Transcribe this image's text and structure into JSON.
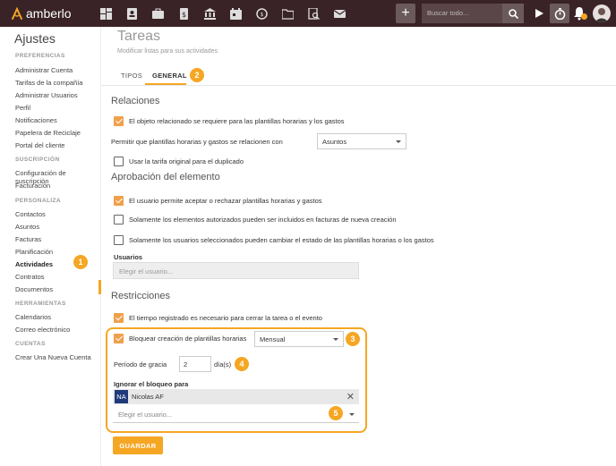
{
  "app": {
    "name": "amberlo"
  },
  "topbar": {
    "nav_icons": [
      "dashboard-icon",
      "contacts-icon",
      "briefcase-icon",
      "invoice-icon",
      "bank-icon",
      "calendar-icon",
      "time-history-icon",
      "folder-icon",
      "document-search-icon",
      "mail-icon"
    ],
    "plus_label": "+",
    "search_placeholder": "Buscar todo..."
  },
  "sidebar": {
    "title": "Ajustes",
    "sections": [
      {
        "label": "PREFERENCIAS",
        "items": [
          "Administrar Cuenta",
          "Tarifas de la compañía",
          "Administrar Usuarios",
          "Perfil",
          "Notificaciones",
          "Papelera de Reciclaje",
          "Portal del cliente"
        ]
      },
      {
        "label": "SUSCRIPCIÓN",
        "items": [
          "Configuración de suscripción",
          "Facturación"
        ]
      },
      {
        "label": "PERSONALIZA",
        "items": [
          "Contactos",
          "Asuntos",
          "Facturas",
          "Planificación",
          "Actividades",
          "Contratos",
          "Documentos"
        ]
      },
      {
        "label": "HERRAMIENTAS",
        "items": [
          "Calendarios",
          "Correo electrónico"
        ]
      },
      {
        "label": "CUENTAS",
        "items": [
          "Crear Una Nueva Cuenta"
        ]
      }
    ],
    "active_item": "Actividades"
  },
  "page": {
    "title": "Tareas",
    "subtitle": "Modificar listas para sus actividades",
    "tabs": [
      "TIPOS",
      "GENERAL"
    ]
  },
  "relaciones": {
    "heading": "Relaciones",
    "cb1_label": "El objeto relacionado se requiere para las plantillas horarias y los gastos",
    "cb1_checked": true,
    "relate_label": "Permitir que plantillas horarias y gastos se relacionen con",
    "relate_value": "Asuntos",
    "cb2_label": "Usar la tarifa original para el duplicado",
    "cb2_checked": false
  },
  "aprobacion": {
    "heading": "Aprobación del elemento",
    "cb1_label": "El usuario permite aceptar o rechazar plantillas horarias y gastos",
    "cb2_label": "Solamente los elementos autorizados pueden ser incluidos en facturas de nueva creación",
    "cb3_label": "Solamente los usuarios seleccionados pueden cambiar el estado de las plantillas horarias o los gastos",
    "users_label": "Usuarios",
    "users_placeholder": "Elegir el usuario..."
  },
  "restricciones": {
    "heading": "Restricciones",
    "cb1_label": "El tiempo registrado es necesario para cerrar la tarea o el evento",
    "cb2_label": "Bloquear creación de plantillas horarias",
    "block_period": "Mensual",
    "grace_label": "Período de gracia",
    "grace_value": "2",
    "grace_unit": "día(s)",
    "ignore_label": "Ignorar el bloqueo para",
    "ignored_user_initials": "NA",
    "ignored_user_name": "Nicolas AF",
    "remove_glyph": "✕",
    "user_placeholder": "Elegir el usuario..."
  },
  "annotations": [
    "1",
    "2",
    "3",
    "4",
    "5"
  ],
  "save_label": "GUARDAR",
  "colors": {
    "accent": "#f5a623",
    "topbar": "#3a2326",
    "checkbox": "#f0a04b"
  }
}
